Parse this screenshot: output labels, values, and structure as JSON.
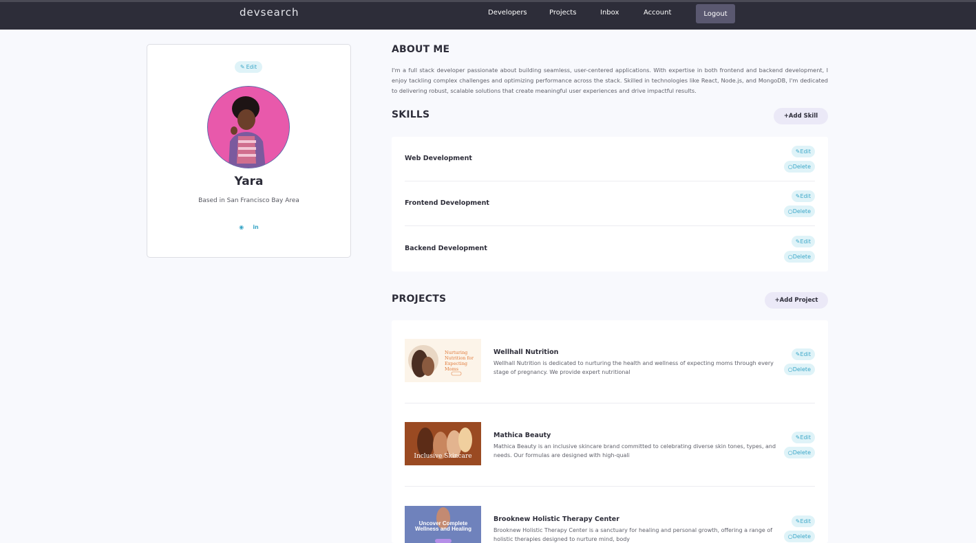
{
  "nav": {
    "logo": "devsearch",
    "links": [
      "Developers",
      "Projects",
      "Inbox",
      "Account"
    ],
    "logout": "Logout"
  },
  "profile": {
    "edit": "Edit",
    "name": "Yara",
    "location": "Based in San Francisco Bay Area",
    "socials": [
      "github-icon",
      "linkedin-icon"
    ]
  },
  "about": {
    "title": "ABOUT ME",
    "text": "I'm a full stack developer passionate about building seamless, user-centered applications. With expertise in both frontend and backend development, I enjoy tackling complex challenges and optimizing performance across the stack. Skilled in technologies like React, Node.js, and MongoDB, I'm dedicated to delivering robust, scalable solutions that create meaningful user experiences and drive impactful results."
  },
  "skills": {
    "title": "SKILLS",
    "add": "+Add Skill",
    "items": [
      {
        "name": "Web Development",
        "edit": "Edit",
        "delete": "Delete"
      },
      {
        "name": "Frontend Development",
        "edit": "Edit",
        "delete": "Delete"
      },
      {
        "name": "Backend Development",
        "edit": "Edit",
        "delete": "Delete"
      }
    ]
  },
  "projects": {
    "title": "PROJECTS",
    "add": "+Add Project",
    "items": [
      {
        "title": "Wellhall Nutrition",
        "desc": "Wellhall Nutrition is dedicated to nurturing the health and wellness of expecting moms through every stage of pregnancy. We provide expert nutritional",
        "thumb_text": "Nurturing Nutrition for Expecting Moms",
        "edit": "Edit",
        "delete": "Delete"
      },
      {
        "title": "Mathica Beauty",
        "desc": "Mathica Beauty is an inclusive skincare brand committed to celebrating diverse skin tones, types, and needs. Our formulas are designed with high-quali",
        "thumb_text": "Inclusive Skincare",
        "edit": "Edit",
        "delete": "Delete"
      },
      {
        "title": "Brooknew Holistic Therapy Center",
        "desc": "Brooknew Holistic Therapy Center is a sanctuary for healing and personal growth, offering a range of holistic therapies designed to nurture mind, body",
        "thumb_text": "Uncover Complete Wellness and Healing",
        "edit": "Edit",
        "delete": "Delete"
      }
    ]
  },
  "colors": {
    "navbar": "#2d2d39",
    "accent": "#3aa6c7",
    "pill_bg": "#dff3f8",
    "add_btn_bg": "#ebe9f7",
    "page_bg": "#f8f9fd"
  }
}
